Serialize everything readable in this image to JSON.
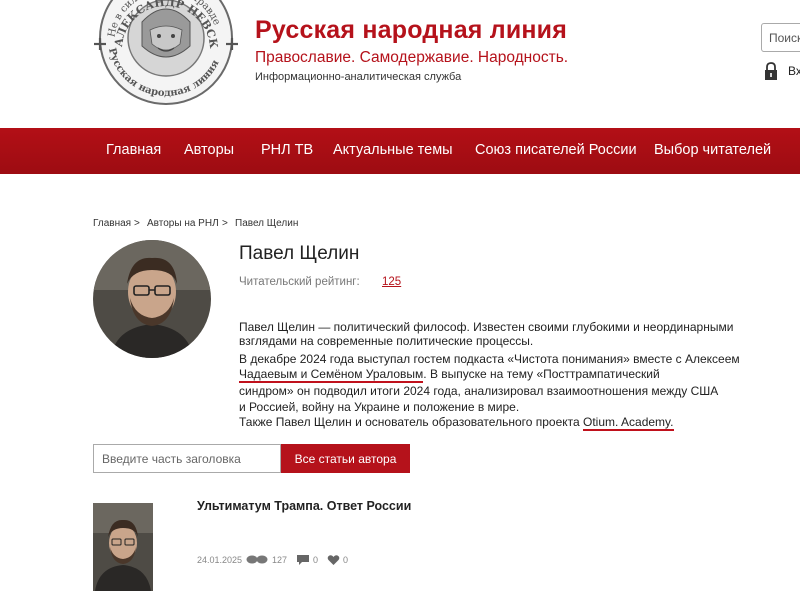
{
  "logo": {
    "ring_top_left": "Не в силе",
    "ring_top_right": "правде",
    "ring_middle": "АЛЕКСАНДР НЕВСКИЙ",
    "ring_bottom": "Русская народная линия"
  },
  "header": {
    "title": "Русская народная линия",
    "slogan": "Православие. Самодержавие. Народность.",
    "subtitle": "Информационно-аналитическая служба",
    "search_placeholder": "Поиск",
    "login_label": "Вход"
  },
  "nav": {
    "items": [
      "Главная",
      "Авторы",
      "РНЛ ТВ",
      "Актуальные темы",
      "Союз писателей России",
      "Выбор читателей"
    ]
  },
  "breadcrumb": {
    "items": [
      "Главная",
      "Авторы на РНЛ",
      "Павел Щелин"
    ],
    "separator": ">"
  },
  "author": {
    "name": "Павел Щелин",
    "rating_label": "Читательский рейтинг:",
    "rating_value": "125",
    "bio": {
      "l1": "Павел Щелин  —  политический философ. Известен своими глубокими и  неординарными",
      "l2": "взглядами на  современные политические процессы.",
      "l3": "В  декабре 2024 года выступал гостем подкаста  «Чистота понимания»  вместе с  Алексеем",
      "l4a": "Чадаевым и  Семёном Ураловым",
      "l4b": ".  В  выпуске на  тему  «Посттрампатический",
      "l5": "синдром»  он  подводил итоги 2024 года, анализировал взаимоотношения между США",
      "l6": "и  Россией, войну на  Украине и  положение в  мире.",
      "l7a": "Также Павел Щелин и  основатель образовательного проекта ",
      "l7b": "Otium. Academy."
    }
  },
  "article_search": {
    "placeholder": "Введите часть заголовка",
    "button_label": "Все статьи автора"
  },
  "articles": [
    {
      "title": "Ультиматум Трампа. Ответ России",
      "date": "24.01.2025",
      "views": "127",
      "comments": "0",
      "likes": "0"
    }
  ],
  "colors": {
    "brand_red": "#b5121b",
    "nav_bg": "#a50e15",
    "underline_red": "#c0111c"
  }
}
